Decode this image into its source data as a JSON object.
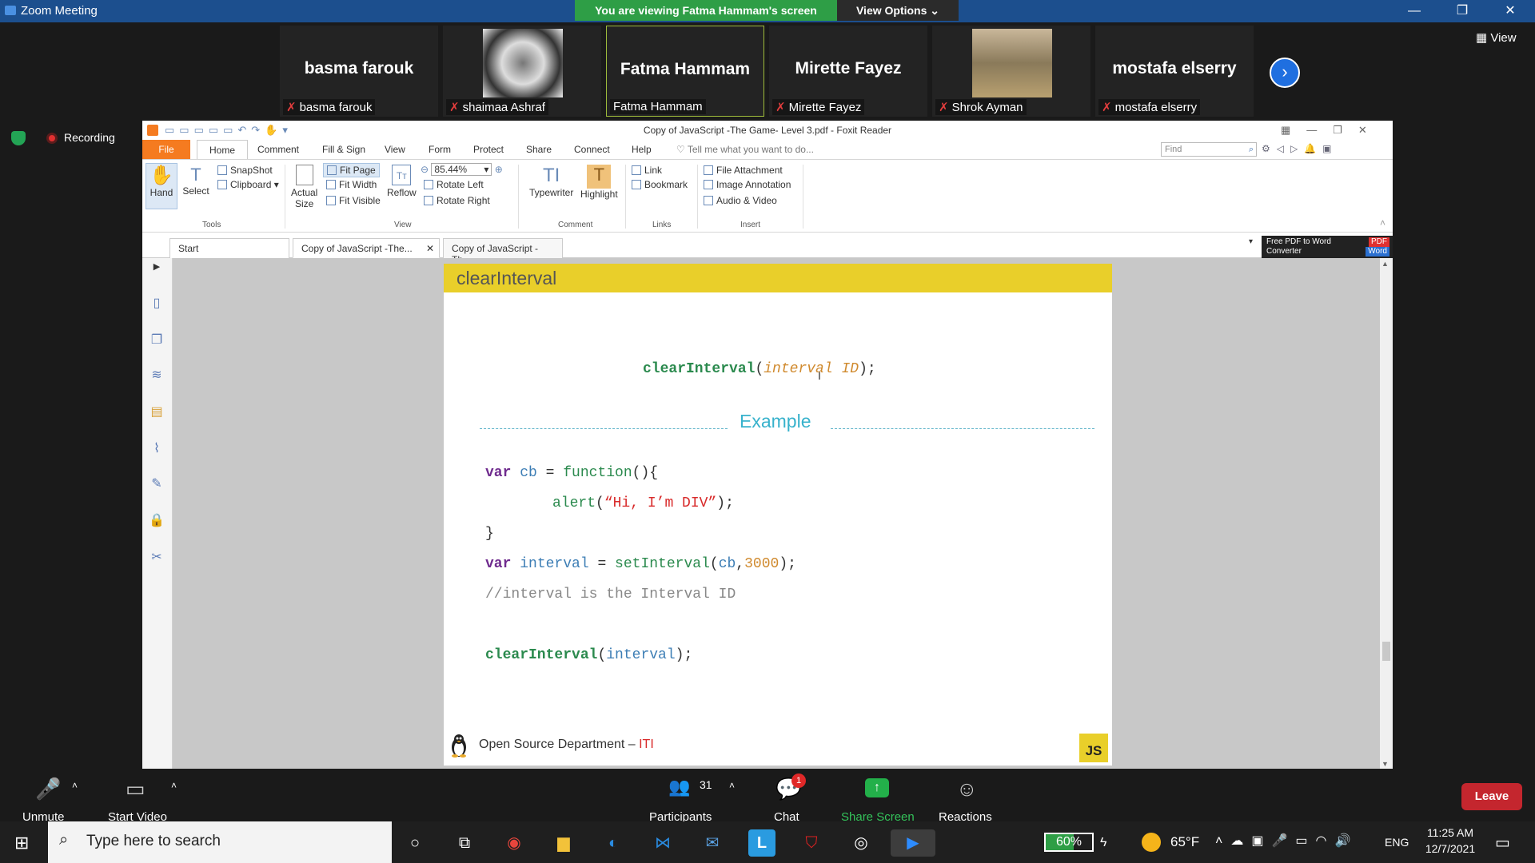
{
  "zoom": {
    "window_title": "Zoom Meeting",
    "viewing_banner": "You are viewing Fatma Hammam's screen",
    "view_options": "View Options ⌄",
    "view_button": "View",
    "recording": "Recording",
    "participants_strip": [
      {
        "display": "basma farouk",
        "label": "basma farouk"
      },
      {
        "display": "",
        "label": "shaimaa Ashraf"
      },
      {
        "display": "Fatma Hammam",
        "label": "Fatma Hammam"
      },
      {
        "display": "Mirette Fayez",
        "label": "Mirette Fayez"
      },
      {
        "display": "",
        "label": "Shrok Ayman"
      },
      {
        "display": "mostafa elserry",
        "label": "mostafa elserry"
      }
    ],
    "toolbar": {
      "unmute": "Unmute",
      "start_video": "Start Video",
      "participants": "Participants",
      "participants_count": "31",
      "chat": "Chat",
      "chat_badge": "1",
      "share_screen": "Share Screen",
      "reactions": "Reactions",
      "leave": "Leave"
    }
  },
  "foxit": {
    "title": "Copy of JavaScript -The Game- Level 3.pdf - Foxit Reader",
    "menu": [
      "File",
      "Home",
      "Comment",
      "Fill & Sign",
      "View",
      "Form",
      "Protect",
      "Share",
      "Connect",
      "Help"
    ],
    "tell_me": "Tell me what you want to do...",
    "find_placeholder": "Find",
    "ribbon": {
      "hand": "Hand",
      "select": "Select",
      "snapshot": "SnapShot",
      "clipboard": "Clipboard",
      "actual_size_1": "Actual",
      "actual_size_2": "Size",
      "fit_page": "Fit Page",
      "fit_width": "Fit Width",
      "fit_visible": "Fit Visible",
      "reflow": "Reflow",
      "zoom_value": "85.44%",
      "rotate_left": "Rotate Left",
      "rotate_right": "Rotate Right",
      "typewriter": "Typewriter",
      "highlight": "Highlight",
      "link": "Link",
      "bookmark": "Bookmark",
      "file_attachment": "File Attachment",
      "image_annotation": "Image Annotation",
      "audio_video": "Audio & Video",
      "groups": {
        "tools": "Tools",
        "view": "View",
        "comment": "Comment",
        "links": "Links",
        "insert": "Insert"
      }
    },
    "tabs": [
      "Start",
      "Copy of JavaScript -The...",
      "Copy of JavaScript -Th..."
    ],
    "ad_line1": "Free PDF to Word",
    "ad_line2": "Converter",
    "ad_badge1": "PDF",
    "ad_badge2": "Word"
  },
  "slide": {
    "title": "clearInterval",
    "syntax_fn": "clearInterval",
    "syntax_open": "(",
    "syntax_param": "interval ID",
    "syntax_close": ");",
    "example": "Example",
    "code": {
      "l1_kw": "var",
      "l1_var": "cb",
      "l1_eq": " = ",
      "l1_fn": "function",
      "l1_end": "(){",
      "l2_fn": "alert",
      "l2_open": "(",
      "l2_str": "“Hi, I’m DIV”",
      "l2_end": ");",
      "l3": "}",
      "l4_kw": "var",
      "l4_var": "interval",
      "l4_eq": " = ",
      "l4_fn": "setInterval",
      "l4_open": "(",
      "l4_arg": "cb",
      "l4_comma": ",",
      "l4_num": "3000",
      "l4_end": ");",
      "l5": "//interval is the Interval ID",
      "l6_fn": "clearInterval",
      "l6_open": "(",
      "l6_arg": "interval",
      "l6_end": ");"
    },
    "footer": "Open Source Department – ",
    "footer_iti": "ITI",
    "badge": "JS"
  },
  "taskbar": {
    "search_placeholder": "Type here to search",
    "battery": "60%",
    "weather": "65°F",
    "lang": "ENG",
    "time": "11:25 AM",
    "date": "12/7/2021"
  },
  "colors": {
    "zoom_title": "#1c4f8e",
    "banner_green": "#2e9e46",
    "foxit_orange": "#f57b20",
    "slide_yellow": "#e9cf2a",
    "leave_red": "#c4262e"
  }
}
